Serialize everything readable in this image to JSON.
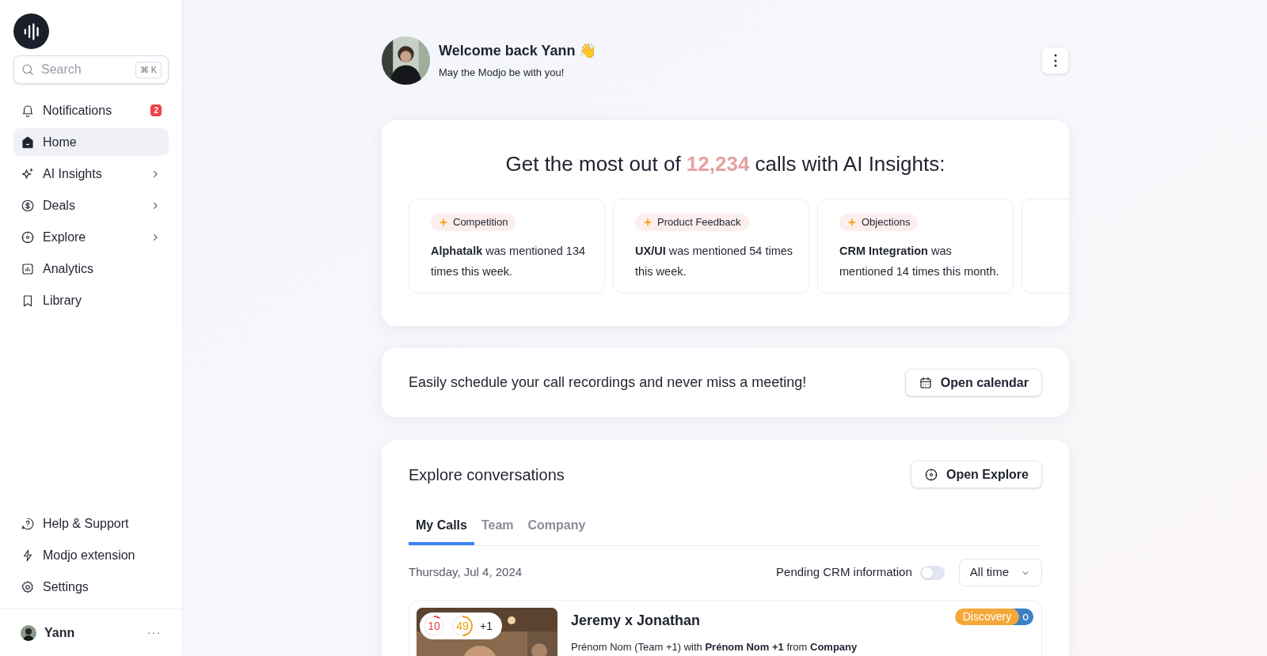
{
  "sidebar": {
    "search": {
      "placeholder": "Search",
      "shortcut": "⌘ K"
    },
    "items": [
      {
        "label": "Notifications",
        "badge": "2",
        "selected": false,
        "submenu": false
      },
      {
        "label": "Home",
        "selected": true,
        "submenu": false
      },
      {
        "label": "AI Insights",
        "selected": false,
        "submenu": true
      },
      {
        "label": "Deals",
        "selected": false,
        "submenu": true
      },
      {
        "label": "Explore",
        "selected": false,
        "submenu": true
      },
      {
        "label": "Analytics",
        "selected": false,
        "submenu": false
      },
      {
        "label": "Library",
        "selected": false,
        "submenu": false
      }
    ],
    "bottom_items": [
      {
        "label": "Help & Support"
      },
      {
        "label": "Modjo extension"
      },
      {
        "label": "Settings"
      }
    ],
    "user": {
      "name": "Yann",
      "more": "···"
    }
  },
  "header": {
    "title": "Welcome back Yann 👋",
    "subtitle": "May the Modjo be with you!",
    "menu": "⋮"
  },
  "insights": {
    "title": "Get the most out of **12,234** calls with AI Insights:",
    "cards": [
      {
        "tag": "Competition",
        "text": "**Alphatalk** was mentioned 134 times this week."
      },
      {
        "tag": "Product Feedback",
        "text": "**UX/UI** was mentioned 54 times this week."
      },
      {
        "tag": "Objections",
        "text": "**CRM Integration** was mentioned 14 times this month."
      }
    ]
  },
  "schedule": {
    "text": "Easily schedule your call recordings and never miss a meeting!",
    "button": "Open calendar"
  },
  "explore": {
    "title": "Explore conversations",
    "button": "Open Explore",
    "tabs": [
      {
        "label": "My Calls",
        "selected": true
      },
      {
        "label": "Team",
        "selected": false
      },
      {
        "label": "Company",
        "selected": false
      }
    ],
    "date": "Thursday, Jul 4, 2024",
    "pending_crm": {
      "label": "Pending CRM information",
      "on": false
    },
    "period": "All time",
    "calls": [
      {
        "title": "Jeremy x Jonathan",
        "details": "Prénom Nom (Team +1) with **Prénom Nom +1** from **Company**",
        "scores": [
          {
            "value": "10",
            "level": 0.1,
            "color": "#ef4444"
          },
          {
            "value": "49",
            "level": 0.49,
            "color": "#f59e0b"
          }
        ],
        "more": "+1",
        "tags": [
          {
            "label": "Discovery",
            "color": "#f5a83a"
          },
          {
            "label": "o",
            "color": "#3b82c4"
          }
        ]
      }
    ]
  }
}
